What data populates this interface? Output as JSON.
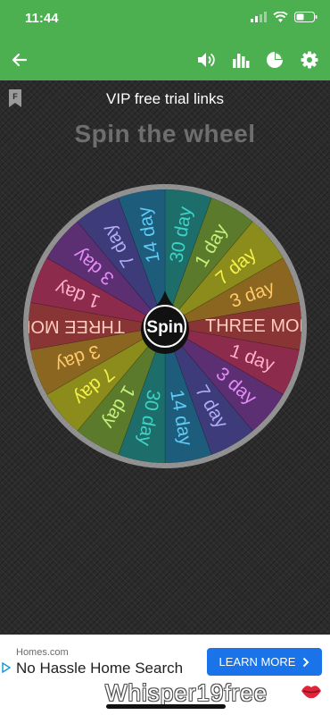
{
  "status": {
    "time": "11:44"
  },
  "app_bar": {
    "back_icon": "arrow-back-icon",
    "actions": [
      "volume-icon",
      "bar-chart-icon",
      "pie-chart-icon",
      "settings-icon"
    ],
    "color": "#4caf50"
  },
  "page": {
    "title": "VIP free trial links",
    "heading": "Spin the wheel"
  },
  "wheel": {
    "center_label": "Spin",
    "segments": [
      {
        "label": "30 day",
        "color": "#1d6e6a",
        "text": "#3fd3c6"
      },
      {
        "label": "1 day",
        "color": "#5b7a2c",
        "text": "#c6ef7c"
      },
      {
        "label": "7 day",
        "color": "#8c8c1c",
        "text": "#f4f04a"
      },
      {
        "label": "3 day",
        "color": "#8a6620",
        "text": "#ffc96a"
      },
      {
        "label": "THREE MONTHS",
        "color": "#8a3535",
        "text": "#ffcdbd"
      },
      {
        "label": "1 day",
        "color": "#8c2b4c",
        "text": "#ffb0c9"
      },
      {
        "label": "3 day",
        "color": "#5c2e72",
        "text": "#e48cf5"
      },
      {
        "label": "7 day",
        "color": "#3e3b7a",
        "text": "#b1adf5"
      },
      {
        "label": "14 day",
        "color": "#1e5c7c",
        "text": "#5ecbf5"
      },
      {
        "label": "30 day",
        "color": "#1d6e6a",
        "text": "#3fd3c6"
      },
      {
        "label": "1 day",
        "color": "#5b7a2c",
        "text": "#c6ef7c"
      },
      {
        "label": "7 day",
        "color": "#8c8c1c",
        "text": "#f4f04a"
      },
      {
        "label": "3 day",
        "color": "#8a6620",
        "text": "#ffc96a"
      },
      {
        "label": "THREE MONTHS",
        "color": "#8a3535",
        "text": "#ffcdbd"
      },
      {
        "label": "1 day",
        "color": "#8c2b4c",
        "text": "#ffb0c9"
      },
      {
        "label": "3 day",
        "color": "#5c2e72",
        "text": "#e48cf5"
      },
      {
        "label": "7 day",
        "color": "#3e3b7a",
        "text": "#b1adf5"
      },
      {
        "label": "14 day",
        "color": "#1e5c7c",
        "text": "#5ecbf5"
      }
    ]
  },
  "ad": {
    "domain": "Homes.com",
    "title": "No Hassle Home Search",
    "button": "LEARN MORE",
    "button_color": "#1a73e8",
    "watermark": "Whisper19free"
  }
}
